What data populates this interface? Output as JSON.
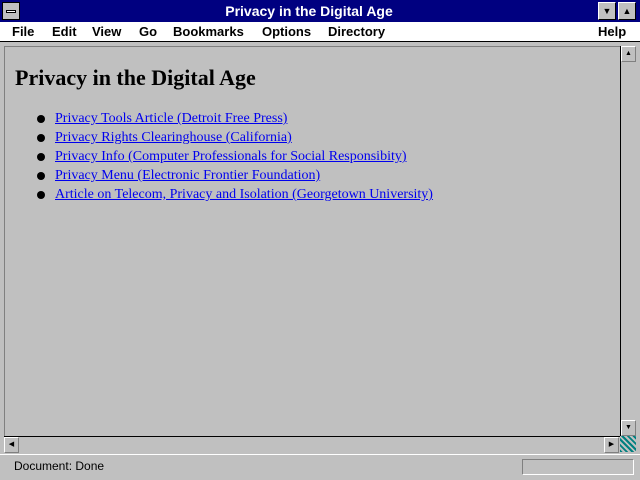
{
  "window": {
    "title": "Privacy in the Digital Age",
    "minimize_icon": "triangle-down",
    "maximize_icon": "triangle-up"
  },
  "menubar": {
    "items": [
      {
        "label": "File"
      },
      {
        "label": "Edit"
      },
      {
        "label": "View"
      },
      {
        "label": "Go"
      },
      {
        "label": "Bookmarks"
      },
      {
        "label": "Options"
      },
      {
        "label": "Directory"
      },
      {
        "label": "Help"
      }
    ]
  },
  "page": {
    "heading": "Privacy in the Digital Age",
    "links": [
      {
        "text": "Privacy Tools Article (Detroit Free Press)"
      },
      {
        "text": "Privacy Rights Clearinghouse (California)"
      },
      {
        "text": "Privacy Info (Computer Professionals for Social Responsibity)"
      },
      {
        "text": "Privacy Menu (Electronic Frontier Foundation)"
      },
      {
        "text": "Article on Telecom, Privacy and Isolation (Georgetown University)"
      }
    ]
  },
  "statusbar": {
    "text": "Document: Done"
  },
  "colors": {
    "titlebar": "#000080",
    "link": "#0000ee",
    "background": "#c0c0c0"
  }
}
